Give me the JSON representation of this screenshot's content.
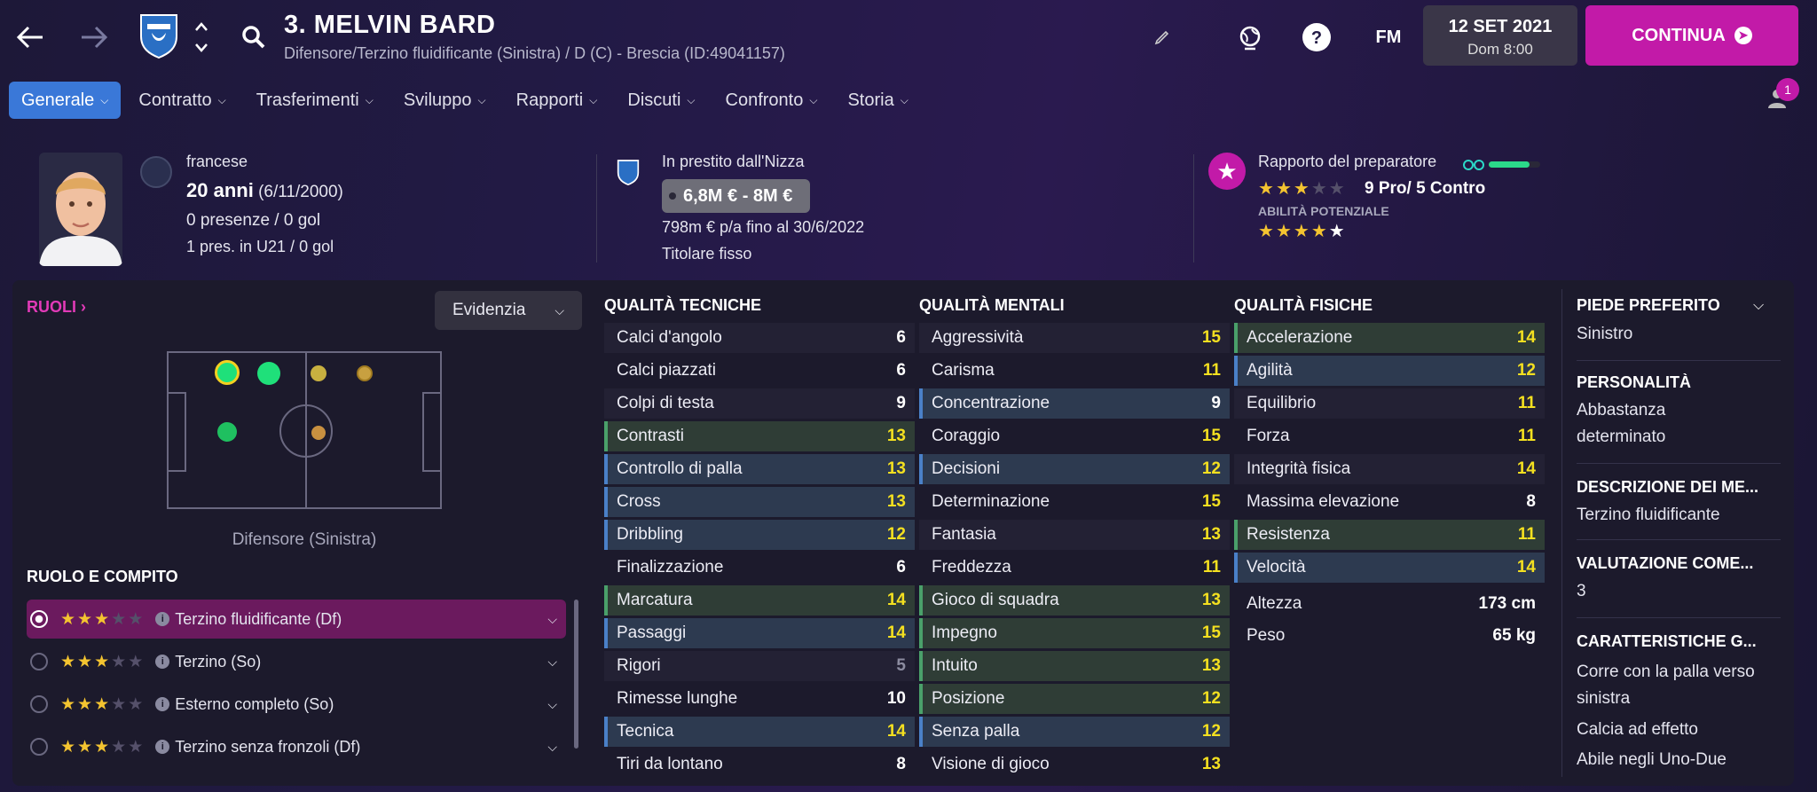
{
  "header": {
    "title": "3. MELVIN BARD",
    "subtitle": "Difensore/Terzino fluidificante (Sinistra) / D (C) - Brescia (ID:49041157)",
    "fm_label": "FM",
    "date_line1": "12 SET 2021",
    "date_line2": "Dom 8:00",
    "continue_label": "CONTINUA"
  },
  "tabs": [
    {
      "label": "Generale"
    },
    {
      "label": "Contratto"
    },
    {
      "label": "Trasferimenti"
    },
    {
      "label": "Sviluppo"
    },
    {
      "label": "Rapporti"
    },
    {
      "label": "Discuti"
    },
    {
      "label": "Confronto"
    },
    {
      "label": "Storia"
    }
  ],
  "notifications": {
    "count": "1"
  },
  "info": {
    "nationality": "francese",
    "age": "20 anni",
    "dob": "(6/11/2000)",
    "apps": "0 presenze / 0 gol",
    "u21": "1 pres. in U21 / 0 gol",
    "loan": "In prestito dall'Nizza",
    "value": "6,8M € - 8M €",
    "wage": "798m € p/a fino al 30/6/2022",
    "status": "Titolare fisso",
    "coach_report": "Rapporto del preparatore",
    "pros_cons": "9 Pro/ 5 Contro",
    "potential_label": "ABILITÀ POTENZIALE",
    "current_stars": 3,
    "potential_stars": 4.5
  },
  "left": {
    "roles_link": "RUOLI",
    "highlight_select": "Evidenzia",
    "position_caption": "Difensore (Sinistra)",
    "role_section": "RUOLO E COMPITO",
    "roles": [
      {
        "label": "Terzino fluidificante (Df)",
        "stars": 3,
        "selected": true
      },
      {
        "label": "Terzino (So)",
        "stars": 3,
        "selected": false
      },
      {
        "label": "Esterno completo (So)",
        "stars": 3,
        "selected": false
      },
      {
        "label": "Terzino senza fronzoli (Df)",
        "stars": 3,
        "selected": false
      }
    ]
  },
  "technical": {
    "title": "QUALITÀ TECNICHE",
    "rows": [
      {
        "name": "Calci d'angolo",
        "value": "6"
      },
      {
        "name": "Calci piazzati",
        "value": "6"
      },
      {
        "name": "Colpi di testa",
        "value": "9"
      },
      {
        "name": "Contrasti",
        "value": "13"
      },
      {
        "name": "Controllo di palla",
        "value": "13"
      },
      {
        "name": "Cross",
        "value": "13"
      },
      {
        "name": "Dribbling",
        "value": "12"
      },
      {
        "name": "Finalizzazione",
        "value": "6"
      },
      {
        "name": "Marcatura",
        "value": "14"
      },
      {
        "name": "Passaggi",
        "value": "14"
      },
      {
        "name": "Rigori",
        "value": "5"
      },
      {
        "name": "Rimesse lunghe",
        "value": "10"
      },
      {
        "name": "Tecnica",
        "value": "14"
      },
      {
        "name": "Tiri da lontano",
        "value": "8"
      }
    ]
  },
  "mental": {
    "title": "QUALITÀ MENTALI",
    "rows": [
      {
        "name": "Aggressività",
        "value": "15"
      },
      {
        "name": "Carisma",
        "value": "11"
      },
      {
        "name": "Concentrazione",
        "value": "9"
      },
      {
        "name": "Coraggio",
        "value": "15"
      },
      {
        "name": "Decisioni",
        "value": "12"
      },
      {
        "name": "Determinazione",
        "value": "15"
      },
      {
        "name": "Fantasia",
        "value": "13"
      },
      {
        "name": "Freddezza",
        "value": "11"
      },
      {
        "name": "Gioco di squadra",
        "value": "13"
      },
      {
        "name": "Impegno",
        "value": "15"
      },
      {
        "name": "Intuito",
        "value": "13"
      },
      {
        "name": "Posizione",
        "value": "12"
      },
      {
        "name": "Senza palla",
        "value": "12"
      },
      {
        "name": "Visione di gioco",
        "value": "13"
      }
    ]
  },
  "physical": {
    "title": "QUALITÀ FISICHE",
    "rows": [
      {
        "name": "Accelerazione",
        "value": "14"
      },
      {
        "name": "Agilità",
        "value": "12"
      },
      {
        "name": "Equilibrio",
        "value": "11"
      },
      {
        "name": "Forza",
        "value": "11"
      },
      {
        "name": "Integrità fisica",
        "value": "14"
      },
      {
        "name": "Massima elevazione",
        "value": "8"
      },
      {
        "name": "Resistenza",
        "value": "11"
      },
      {
        "name": "Velocità",
        "value": "14"
      }
    ],
    "height_label": "Altezza",
    "height": "173 cm",
    "weight_label": "Peso",
    "weight": "65 kg"
  },
  "side": {
    "foot_title": "PIEDE PREFERITO",
    "foot": "Sinistro",
    "personality_title": "PERSONALITÀ",
    "personality": "Abbastanza determinato",
    "media_title": "DESCRIZIONE DEI ME...",
    "media": "Terzino fluidificante",
    "rating_title": "VALUTAZIONE COME...",
    "rating": "3",
    "traits_title": "CARATTERISTICHE G...",
    "trait1": "Corre con la palla verso sinistra",
    "trait2": "Calcia ad effetto",
    "trait3": "Abile negli Uno-Due"
  },
  "colors": {
    "accent": "#c21aa8",
    "tab_active": "#3a78d8",
    "value_yellow": "#f4e020",
    "star": "#f4c430"
  }
}
